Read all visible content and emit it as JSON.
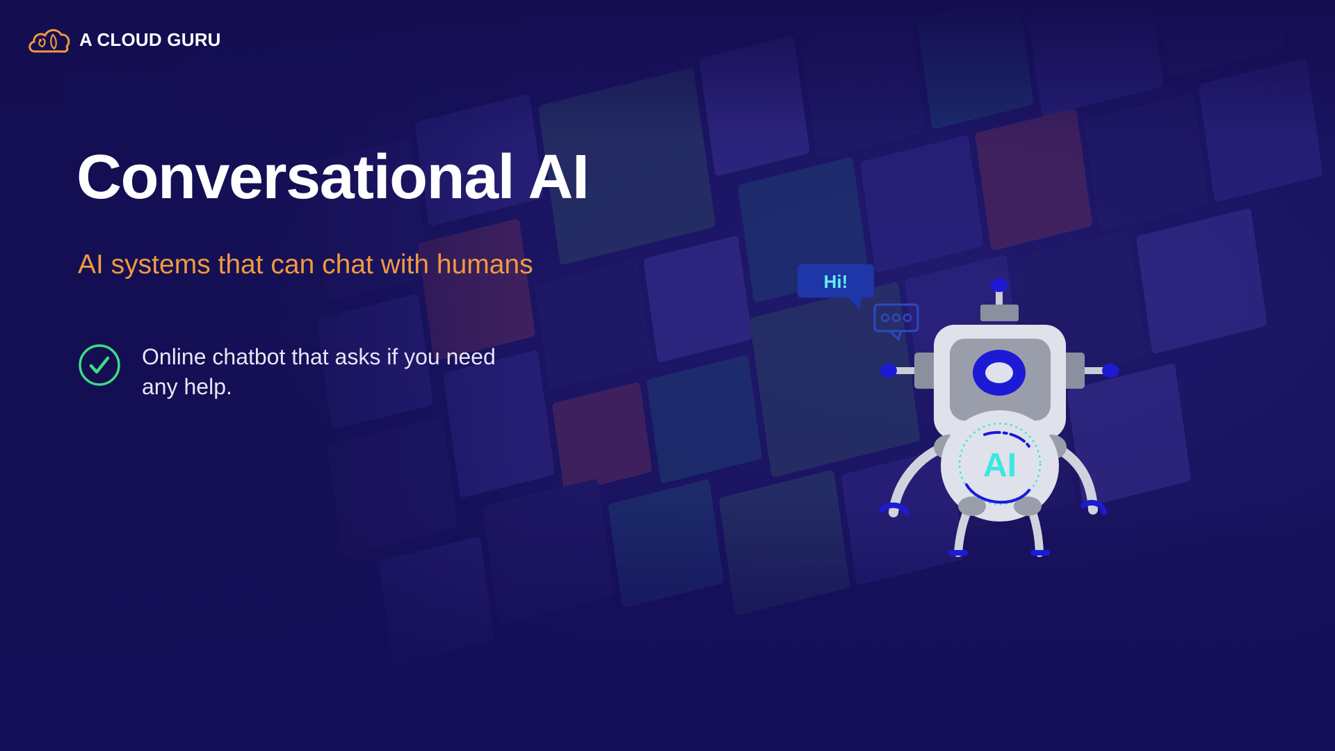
{
  "brand": {
    "name": "A CLOUD GURU",
    "logo_icon": "cloud-logo-icon",
    "logo_color": "#f19a3e"
  },
  "slide": {
    "title": "Conversational AI",
    "subtitle": "AI systems that can chat with humans",
    "bullets": [
      {
        "icon": "check-circle-icon",
        "text": "Online chatbot that asks if you need any help."
      }
    ]
  },
  "illustration": {
    "speech_bubble_text": "Hi!",
    "chest_label": "AI",
    "icons": [
      "speech-bubble-icon",
      "typing-bubble-icon",
      "robot-illustration"
    ]
  },
  "colors": {
    "background": "#15105a",
    "accent_orange": "#f19a3e",
    "check_green": "#3ddc84",
    "robot_blue": "#1d1ad6",
    "ai_cyan": "#3ee6e0"
  }
}
